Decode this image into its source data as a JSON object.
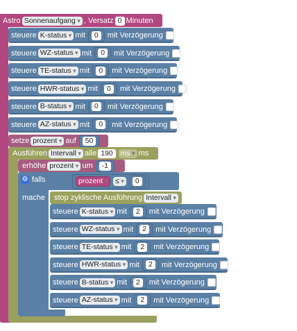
{
  "astro": {
    "label": "Astro",
    "event": "Sonnenaufgang",
    "versatz_label": ", Versatz",
    "versatz_value": "0",
    "minuten": "Minuten"
  },
  "common": {
    "steuere": "steuere",
    "mit": "mit",
    "verzoegerung": "mit Verzögerung",
    "value": "0"
  },
  "steuere_top": [
    {
      "device": "K-status"
    },
    {
      "device": "WZ-status"
    },
    {
      "device": "TE-status"
    },
    {
      "device": "HWR-status"
    },
    {
      "device": "B-status"
    },
    {
      "device": "AZ-status"
    }
  ],
  "setze": {
    "label": "setze",
    "var": "prozent",
    "auf": "auf",
    "value": "50"
  },
  "ausfuehren": {
    "label": "Ausführen",
    "var": "Intervall",
    "alle": "alle",
    "value": "190",
    "unit": "ms",
    "unit_suffix": "ms"
  },
  "erhoehe": {
    "label": "erhöhe",
    "var": "prozent",
    "um": "um",
    "value": "-1"
  },
  "falls": {
    "label": "falls",
    "var": "prozent",
    "op": "≤",
    "value": "0",
    "mache": "mache"
  },
  "stop": {
    "label": "stop zyklische Ausführung",
    "var": "Intervall"
  },
  "steuere_inner": [
    {
      "device": "K-status",
      "value": "2"
    },
    {
      "device": "WZ-status",
      "value": "2"
    },
    {
      "device": "TE-status",
      "value": "2"
    },
    {
      "device": "HWR-status",
      "value": "2"
    },
    {
      "device": "B-status",
      "value": "2"
    },
    {
      "device": "AZ-status",
      "value": "2"
    }
  ],
  "colors": {
    "astro": "#b2477f",
    "steuere": "#5b80a5",
    "setze": "#a65c81",
    "olive": "#9aa15e"
  },
  "icons": {
    "gear": "gear-icon",
    "checkbox": "checkbox-icon"
  }
}
